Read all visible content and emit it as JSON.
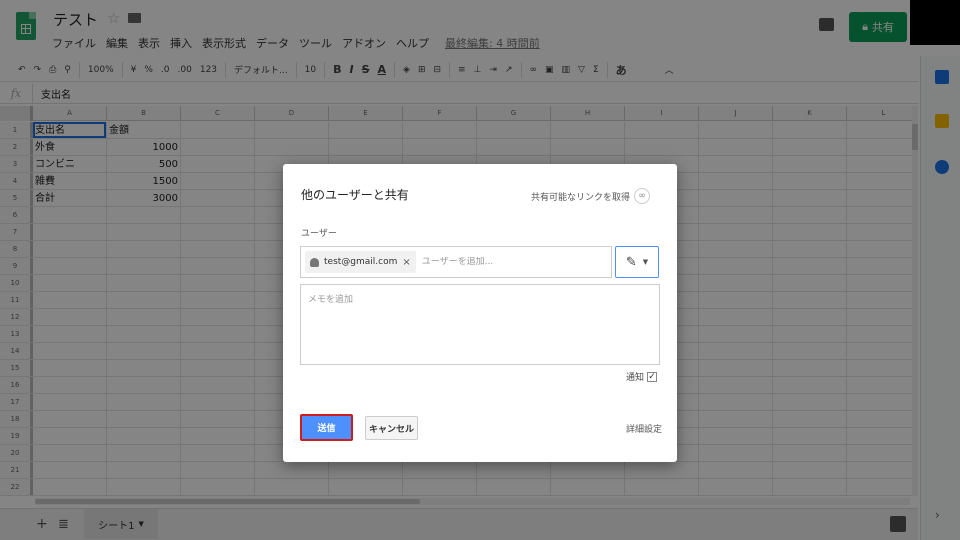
{
  "header": {
    "title": "テスト",
    "share_label": "共有",
    "last_edit": "最終編集: 4 時間前",
    "menu": [
      "ファイル",
      "編集",
      "表示",
      "挿入",
      "表示形式",
      "データ",
      "ツール",
      "アドオン",
      "ヘルプ"
    ]
  },
  "toolbar": {
    "undo": "↶",
    "redo": "↷",
    "print": "⎙",
    "paint": "⚲",
    "zoom": "100%",
    "currency": "¥",
    "percent": "%",
    "dec_less": ".0",
    "dec_more": ".00",
    "format_more": "123",
    "font": "デフォルト...",
    "font_size": "10",
    "bold": "B",
    "italic": "I",
    "strike": "S",
    "text_color": "A",
    "ime": "あ"
  },
  "formula_bar": {
    "fx": "fx",
    "content": "支出名"
  },
  "grid": {
    "columns": [
      "A",
      "B",
      "C",
      "D",
      "E",
      "F",
      "G",
      "H",
      "I",
      "J",
      "K",
      "L"
    ],
    "row_numbers": [
      "1",
      "2",
      "3",
      "4",
      "5",
      "6",
      "7",
      "8",
      "9",
      "10",
      "11",
      "12",
      "13",
      "14",
      "15",
      "16",
      "17",
      "18",
      "19",
      "20",
      "21",
      "22"
    ],
    "data": [
      [
        "支出名",
        "金額"
      ],
      [
        "外食",
        "1000"
      ],
      [
        "コンビニ",
        "500"
      ],
      [
        "雑費",
        "1500"
      ],
      [
        "合計",
        "3000"
      ]
    ]
  },
  "sheet_tabs": {
    "active": "シート1"
  },
  "dialog": {
    "title": "他のユーザーと共有",
    "get_link": "共有可能なリンクを取得",
    "users_label": "ユーザー",
    "chip_email": "test@gmail.com",
    "add_user_placeholder": "ユーザーを追加...",
    "note_placeholder": "メモを追加",
    "notify_label": "通知",
    "send_label": "送信",
    "cancel_label": "キャンセル",
    "advanced_label": "詳細設定"
  }
}
